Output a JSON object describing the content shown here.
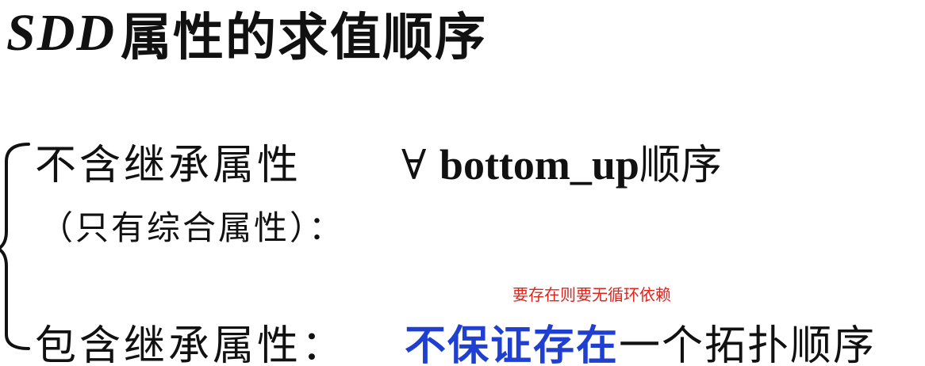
{
  "title": {
    "prefix": "SDD",
    "main": "属性的求值顺序"
  },
  "cases": [
    {
      "label": "不含继承属性",
      "sub_label": "（只有综合属性）：",
      "forall_symbol": "∀",
      "value_latin": "bottom_up",
      "value_cjk": "顺序"
    },
    {
      "label": "包含继承属性：",
      "value_highlight": "不保证存在",
      "value_rest": "一个拓扑顺序",
      "annotation": "要存在则要无循环依赖"
    }
  ],
  "colors": {
    "highlight": "#1f3fd0",
    "annotation": "#e0241c",
    "text": "#111111"
  }
}
